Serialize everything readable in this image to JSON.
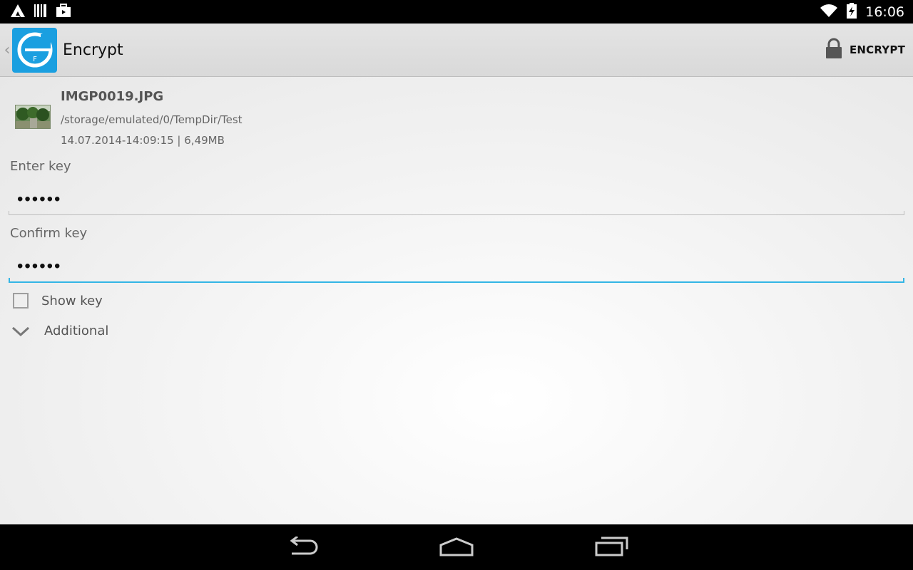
{
  "status_bar": {
    "time": "16:06",
    "left_icons": [
      "app-notification-icon",
      "barcode-icon",
      "briefcase-icon"
    ],
    "right_icons": [
      "wifi-icon",
      "battery-charging-icon"
    ]
  },
  "action_bar": {
    "title": "Encrypt",
    "logo_icon": "app-logo-icon",
    "encrypt_label": "ENCRYPT",
    "encrypt_icon": "lock-icon"
  },
  "file": {
    "name": "IMGP0019.JPG",
    "path": "/storage/emulated/0/TempDir/Test",
    "meta": "14.07.2014-14:09:15 | 6,49MB"
  },
  "form": {
    "enter_key_label": "Enter key",
    "enter_key_value": "••••••",
    "confirm_key_label": "Confirm key",
    "confirm_key_value": "••••••",
    "show_key_label": "Show key",
    "show_key_checked": false,
    "additional_label": "Additional"
  },
  "nav_bar": {
    "buttons": [
      "back-icon",
      "home-icon",
      "recents-icon"
    ]
  },
  "colors": {
    "accent": "#33b5e5",
    "logo_blue": "#1a9fe0"
  }
}
